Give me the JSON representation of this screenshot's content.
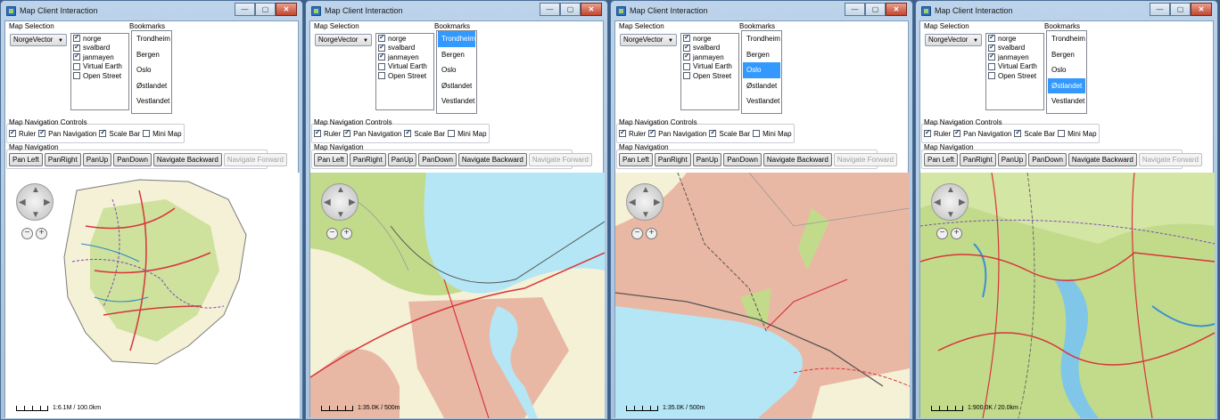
{
  "windows": [
    {
      "title": "Map Client Interaction",
      "map_selection_label": "Map Selection",
      "map_selection_value": "NorgeVector",
      "layers": [
        {
          "label": "norge",
          "checked": true
        },
        {
          "label": "svalbard",
          "checked": true
        },
        {
          "label": "janmayen",
          "checked": true
        },
        {
          "label": "Virtual Earth",
          "checked": false
        },
        {
          "label": "Open Street",
          "checked": false
        }
      ],
      "bookmarks_label": "Bookmarks",
      "bookmarks": [
        "Trondheim",
        "Bergen",
        "Oslo",
        "Østlandet",
        "Vestlandet"
      ],
      "selected_bookmark": "",
      "nav_controls_label": "Map Navigation Controls",
      "nav_controls": [
        {
          "label": "Ruler",
          "checked": true
        },
        {
          "label": "Pan Navigation",
          "checked": true
        },
        {
          "label": "Scale Bar",
          "checked": true
        },
        {
          "label": "Mini Map",
          "checked": false
        }
      ],
      "nav_label": "Map Navigation",
      "nav_buttons": [
        "Pan Left",
        "PanRight",
        "PanUp",
        "PanDown",
        "Navigate Backward",
        "Navigate Forward"
      ],
      "scale_text": "1:6.1M / 100.0km",
      "map_view": "overview"
    },
    {
      "title": "Map Client Interaction",
      "map_selection_label": "Map Selection",
      "map_selection_value": "NorgeVector",
      "layers": [
        {
          "label": "norge",
          "checked": true
        },
        {
          "label": "svalbard",
          "checked": true
        },
        {
          "label": "janmayen",
          "checked": true
        },
        {
          "label": "Virtual Earth",
          "checked": false
        },
        {
          "label": "Open Street",
          "checked": false
        }
      ],
      "bookmarks_label": "Bookmarks",
      "bookmarks": [
        "Trondheim",
        "Bergen",
        "Oslo",
        "Østlandet",
        "Vestlandet"
      ],
      "selected_bookmark": "Trondheim",
      "nav_controls_label": "Map Navigation Controls",
      "nav_controls": [
        {
          "label": "Ruler",
          "checked": true
        },
        {
          "label": "Pan Navigation",
          "checked": true
        },
        {
          "label": "Scale Bar",
          "checked": true
        },
        {
          "label": "Mini Map",
          "checked": false
        }
      ],
      "nav_label": "Map Navigation",
      "nav_buttons": [
        "Pan Left",
        "PanRight",
        "PanUp",
        "PanDown",
        "Navigate Backward",
        "Navigate Forward"
      ],
      "scale_text": "1:35.0K / 500m",
      "map_view": "trondheim"
    },
    {
      "title": "Map Client Interaction",
      "map_selection_label": "Map Selection",
      "map_selection_value": "NorgeVector",
      "layers": [
        {
          "label": "norge",
          "checked": true
        },
        {
          "label": "svalbard",
          "checked": true
        },
        {
          "label": "janmayen",
          "checked": true
        },
        {
          "label": "Virtual Earth",
          "checked": false
        },
        {
          "label": "Open Street",
          "checked": false
        }
      ],
      "bookmarks_label": "Bookmarks",
      "bookmarks": [
        "Trondheim",
        "Bergen",
        "Oslo",
        "Østlandet",
        "Vestlandet"
      ],
      "selected_bookmark": "Oslo",
      "nav_controls_label": "Map Navigation Controls",
      "nav_controls": [
        {
          "label": "Ruler",
          "checked": true
        },
        {
          "label": "Pan Navigation",
          "checked": true
        },
        {
          "label": "Scale Bar",
          "checked": true
        },
        {
          "label": "Mini Map",
          "checked": false
        }
      ],
      "nav_label": "Map Navigation",
      "nav_buttons": [
        "Pan Left",
        "PanRight",
        "PanUp",
        "PanDown",
        "Navigate Backward",
        "Navigate Forward"
      ],
      "scale_text": "1:35.0K / 500m",
      "map_view": "oslo"
    },
    {
      "title": "Map Client Interaction",
      "map_selection_label": "Map Selection",
      "map_selection_value": "NorgeVector",
      "layers": [
        {
          "label": "norge",
          "checked": true
        },
        {
          "label": "svalbard",
          "checked": true
        },
        {
          "label": "janmayen",
          "checked": true
        },
        {
          "label": "Virtual Earth",
          "checked": false
        },
        {
          "label": "Open Street",
          "checked": false
        }
      ],
      "bookmarks_label": "Bookmarks",
      "bookmarks": [
        "Trondheim",
        "Bergen",
        "Oslo",
        "Østlandet",
        "Vestlandet"
      ],
      "selected_bookmark": "Østlandet",
      "nav_controls_label": "Map Navigation Controls",
      "nav_controls": [
        {
          "label": "Ruler",
          "checked": true
        },
        {
          "label": "Pan Navigation",
          "checked": true
        },
        {
          "label": "Scale Bar",
          "checked": true
        },
        {
          "label": "Mini Map",
          "checked": false
        }
      ],
      "nav_label": "Map Navigation",
      "nav_buttons": [
        "Pan Left",
        "PanRight",
        "PanUp",
        "PanDown",
        "Navigate Backward",
        "Navigate Forward"
      ],
      "scale_text": "1:900.0K / 20.0km",
      "map_view": "ostlandet"
    }
  ],
  "disabled_button": "Navigate Forward",
  "window_buttons": {
    "minimize": "—",
    "maximize": "▢",
    "close": "✕"
  },
  "pan_glyphs": {
    "up": "▲",
    "down": "▼",
    "left": "◀",
    "right": "▶",
    "zoom_out": "−",
    "zoom_in": "+"
  },
  "colors": {
    "selected": "#3399ff",
    "water": "#b5e6f5",
    "land": "#f4f1d6",
    "forest": "#c2db8a",
    "urban": "#e9b8a4",
    "road": "#d8343a",
    "admin": "#7b4bb6"
  }
}
